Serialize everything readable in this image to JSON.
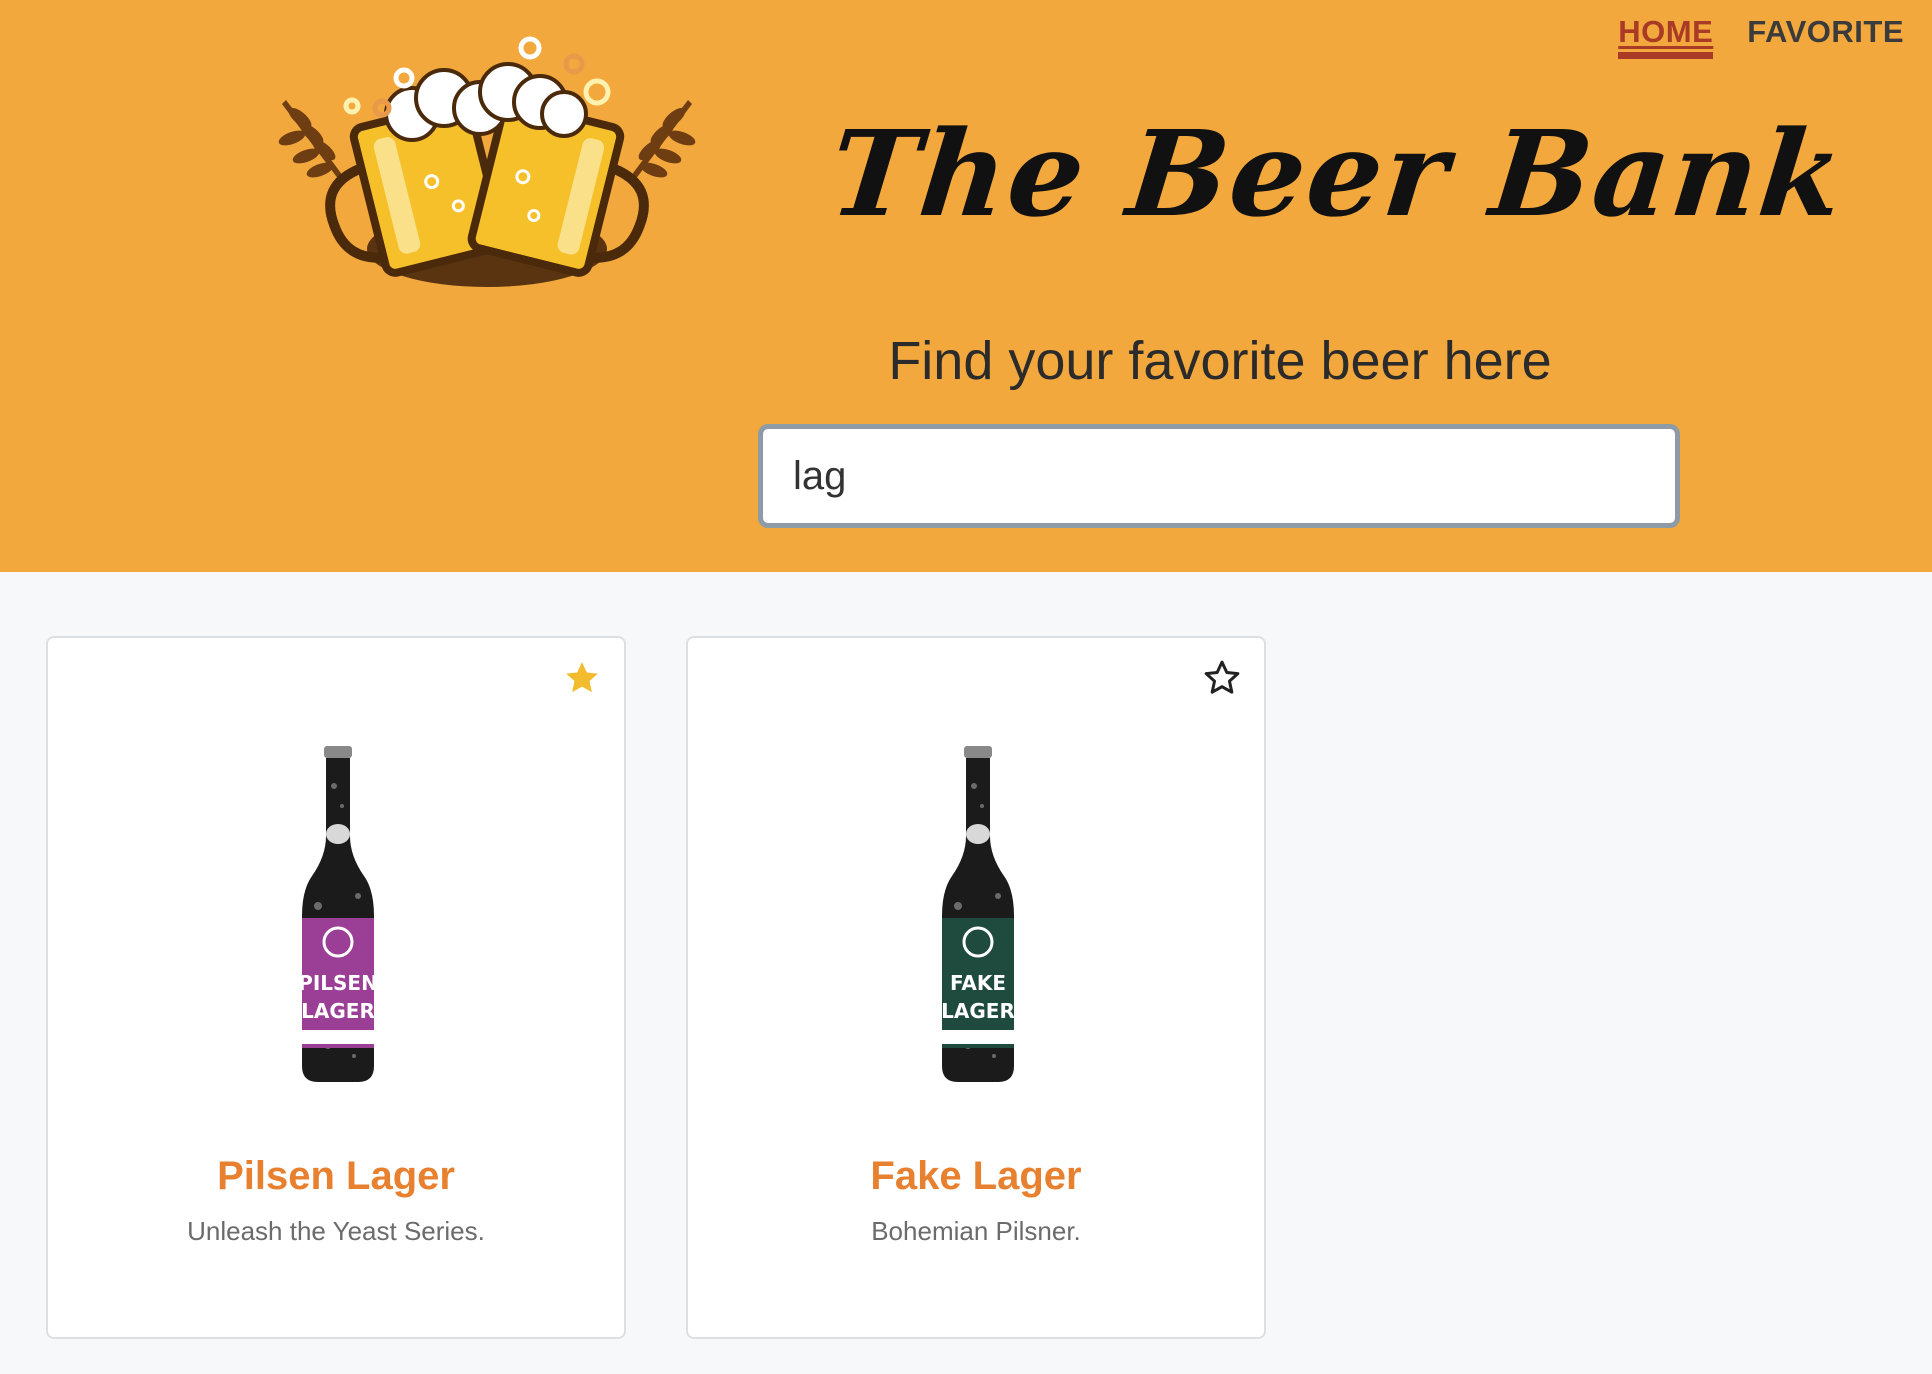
{
  "nav": {
    "home_label": "HOME",
    "favorite_label": "FAVORITE",
    "active": "home"
  },
  "header": {
    "title": "The Beer Bank",
    "subtitle": "Find your favorite beer here"
  },
  "search": {
    "value": "lag",
    "placeholder": ""
  },
  "beers": [
    {
      "name": "Pilsen Lager",
      "tagline": "Unleash the Yeast Series.",
      "favorite": true,
      "label_text_top": "PILSEN",
      "label_text_bottom": "LAGER",
      "label_color": "#9b3f96"
    },
    {
      "name": "Fake Lager",
      "tagline": "Bohemian Pilsner.",
      "favorite": false,
      "label_text_top": "FAKE",
      "label_text_bottom": "LAGER",
      "label_color": "#1f4a3e"
    }
  ],
  "colors": {
    "header_bg": "#f2a83c",
    "nav_active": "#a83a26",
    "beer_name": "#e8812f",
    "star_filled": "#f3bc2e"
  },
  "icons": {
    "logo": "beer-mugs-logo",
    "favorite_filled": "star-filled-icon",
    "favorite_outline": "star-outline-icon"
  }
}
